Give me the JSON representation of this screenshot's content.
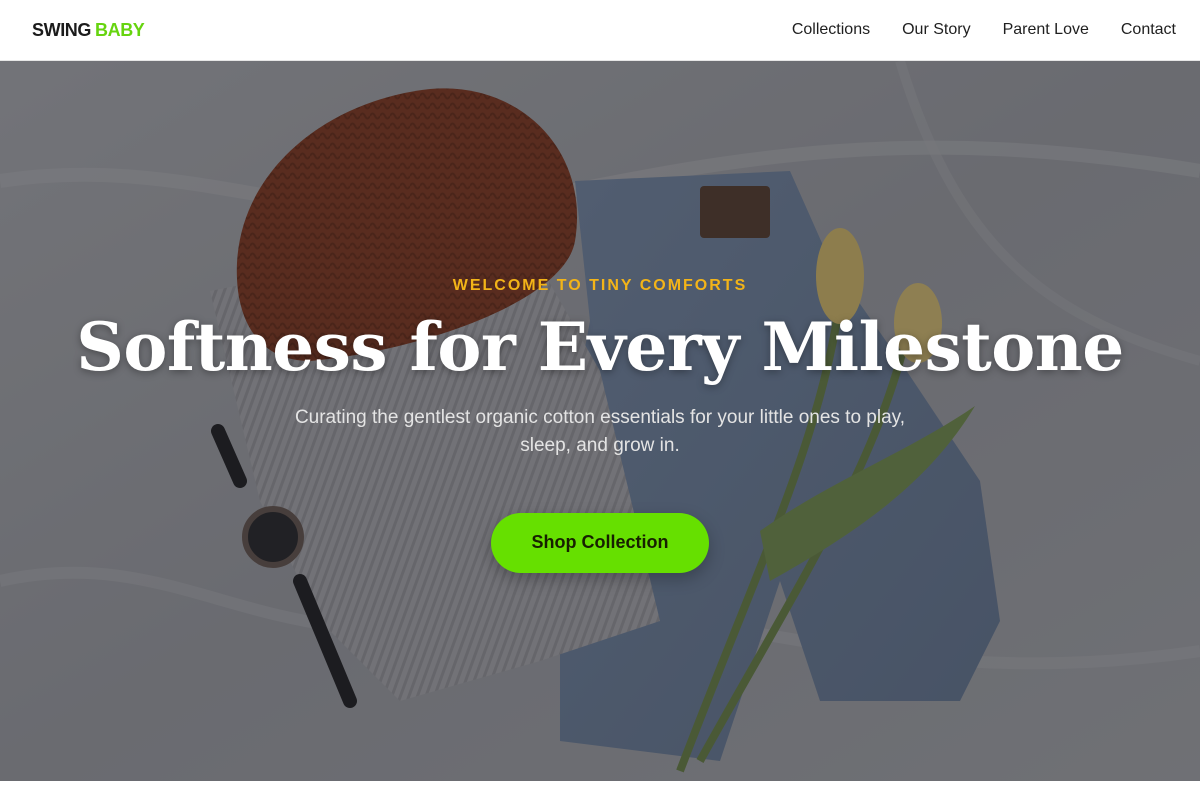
{
  "header": {
    "logo_part1": "SWING",
    "logo_part2": "BABY",
    "nav": [
      {
        "label": "Collections"
      },
      {
        "label": "Our Story"
      },
      {
        "label": "Parent Love"
      },
      {
        "label": "Contact"
      }
    ]
  },
  "hero": {
    "eyebrow": "WELCOME TO TINY COMFORTS",
    "title": "Softness for Every Milestone",
    "subtitle": "Curating the gentlest organic cotton essentials for your little ones to play, sleep, and grow in.",
    "cta_label": "Shop Collection",
    "background_image": "flat-lay-knit-beanie-sweater-jeans-watch-tulips"
  },
  "colors": {
    "brand_dark": "#1b1b1b",
    "brand_green": "#66d40f",
    "accent_yellow": "#f3b418",
    "cta_green": "#66e000"
  }
}
